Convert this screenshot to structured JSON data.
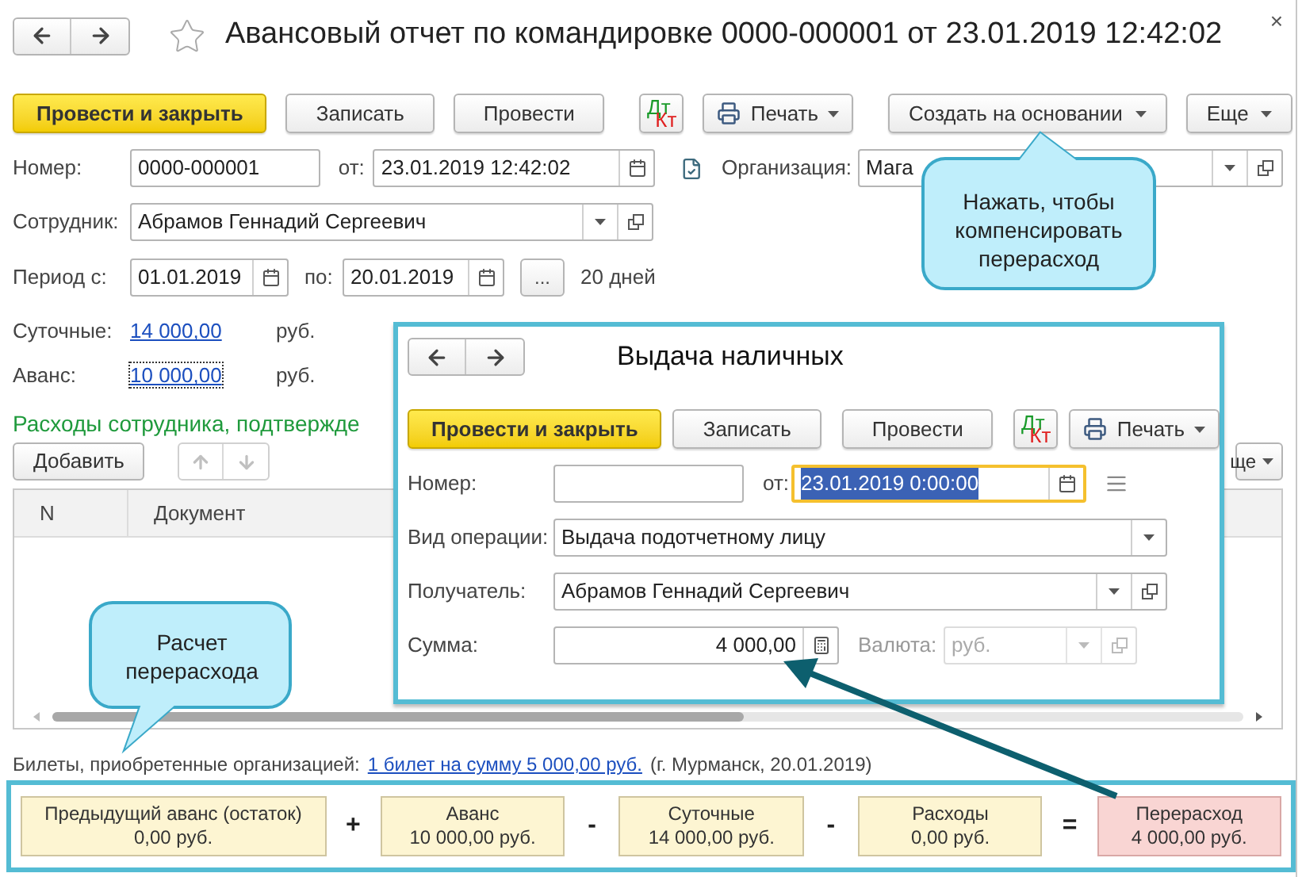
{
  "window": {
    "title": "Авансовый отчет по командировке 0000-000001 от 23.01.2019 12:42:02",
    "close": "×",
    "favorite": false
  },
  "toolbar": [
    {
      "kind": "primary",
      "label": "Провести и закрыть"
    },
    {
      "kind": "plain",
      "label": "Записать"
    },
    {
      "kind": "plain",
      "label": "Провести"
    },
    {
      "kind": "dtkt",
      "dt": "Дт",
      "kt": "Кт"
    },
    {
      "kind": "print",
      "label": "Печать"
    },
    {
      "kind": "menu",
      "label": "Создать на основании"
    },
    {
      "kind": "menu",
      "label": "Еще"
    }
  ],
  "number": {
    "label": "Номер:",
    "value": "0000-000001"
  },
  "date": {
    "label": "от:",
    "value": "23.01.2019 12:42:02"
  },
  "organization": {
    "label": "Организация:",
    "value": "Мага"
  },
  "employee": {
    "label": "Сотрудник:",
    "value": "Абрамов Геннадий Сергеевич"
  },
  "period": {
    "label_from": "Период с:",
    "from": "01.01.2019",
    "label_to": "по:",
    "to": "20.01.2019",
    "button": "...",
    "days": "20 дней"
  },
  "amounts": [
    {
      "label": "Суточные:",
      "value": "14 000,00",
      "unit": "руб.",
      "focused": false
    },
    {
      "label": "Аванс:",
      "value": "10 000,00",
      "unit": "руб.",
      "focused": true
    }
  ],
  "expenses": {
    "title": "Расходы сотрудника, подтвержде",
    "add": "Добавить",
    "move_disabled": true,
    "more": "ще",
    "columns": [
      "N",
      "Документ"
    ]
  },
  "tickets": {
    "label": "Билеты, приобретенные организацией:",
    "link": "1 билет на сумму 5 000,00 руб.",
    "note": "(г. Мурманск, 20.01.2019)"
  },
  "formula": [
    {
      "kind": "term",
      "label": "Предыдущий аванс (остаток)",
      "value": "0,00 руб."
    },
    {
      "kind": "op",
      "label": "+"
    },
    {
      "kind": "term",
      "label": "Аванс",
      "value": "10 000,00 руб."
    },
    {
      "kind": "op",
      "label": "-"
    },
    {
      "kind": "term",
      "label": "Суточные",
      "value": "14 000,00 руб."
    },
    {
      "kind": "op",
      "label": "-"
    },
    {
      "kind": "term",
      "label": "Расходы",
      "value": "0,00 руб."
    },
    {
      "kind": "op",
      "label": "="
    },
    {
      "kind": "result",
      "label": "Перерасход",
      "value": "4 000,00 руб."
    }
  ],
  "dialog": {
    "title": "Выдача наличных",
    "toolbar": [
      {
        "kind": "primary",
        "label": "Провести и закрыть"
      },
      {
        "kind": "plain",
        "label": "Записать"
      },
      {
        "kind": "plain",
        "label": "Провести"
      },
      {
        "kind": "dtkt",
        "dt": "Дт",
        "kt": "Кт"
      },
      {
        "kind": "print",
        "label": "Печать"
      }
    ],
    "number": {
      "label": "Номер:"
    },
    "date": {
      "label": "от:",
      "value": "23.01.2019  0:00:00",
      "focused": true
    },
    "operation": {
      "label": "Вид операции:",
      "value": "Выдача подотчетному лицу"
    },
    "recipient": {
      "label": "Получатель:",
      "value": "Абрамов Геннадий Сергеевич"
    },
    "sum": {
      "label": "Сумма:",
      "value": "4 000,00"
    },
    "currency": {
      "label": "Валюта:",
      "value": "руб.",
      "disabled": true
    }
  },
  "callouts": [
    {
      "text": "Нажать, чтобы компенсировать перерасход"
    },
    {
      "text": "Расчет перерасхода"
    }
  ]
}
